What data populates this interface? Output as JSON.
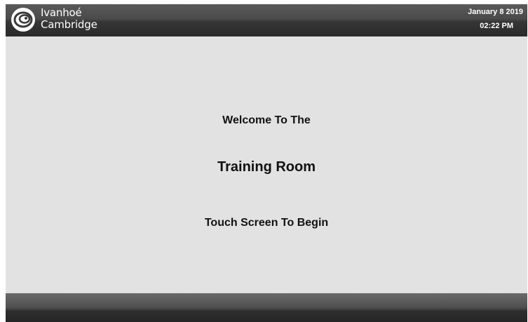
{
  "header": {
    "logo_line1": "Ivanhoé",
    "logo_line2": "Cambridge",
    "date": "January 8 2019",
    "time": "02:22 PM"
  },
  "main": {
    "welcome": "Welcome To The",
    "room_name": "Training Room",
    "prompt": "Touch Screen To Begin"
  },
  "colors": {
    "background": "#e2e2e2",
    "bar": "#2e2e2e",
    "text": "#111111"
  }
}
